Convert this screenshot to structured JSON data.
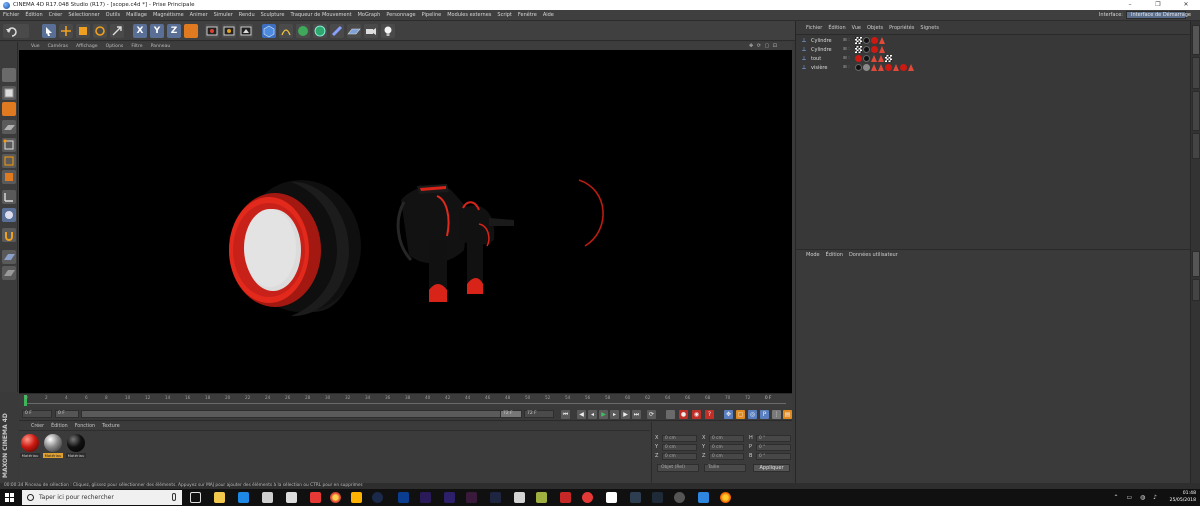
{
  "window": {
    "title": "CINEMA 4D R17.048 Studio (R17) - [scope.c4d *] - Prise Principale",
    "minimize": "–",
    "maximize": "❐",
    "close": "✕"
  },
  "menu": [
    "Fichier",
    "Édition",
    "Créer",
    "Sélectionner",
    "Outils",
    "Maillage",
    "Magnétisme",
    "Animer",
    "Simuler",
    "Rendu",
    "Sculpture",
    "Traqueur de Mouvement",
    "MoGraph",
    "Personnage",
    "Pipeline",
    "Modules externes",
    "Script",
    "Fenêtre",
    "Aide"
  ],
  "interface": {
    "label": "Interface:",
    "value": "Interface de Démarrage"
  },
  "toolbar": {
    "axes": [
      "X",
      "Y",
      "Z"
    ]
  },
  "viewport": {
    "menu": [
      "Vue",
      "Caméras",
      "Affichage",
      "Options",
      "Filtre",
      "Panneau"
    ],
    "controls": "✥ ⟳ ▢ ⊡"
  },
  "timeline": {
    "ticks": [
      "0",
      "2",
      "4",
      "6",
      "8",
      "10",
      "12",
      "14",
      "16",
      "18",
      "20",
      "22",
      "24",
      "26",
      "28",
      "30",
      "32",
      "34",
      "36",
      "38",
      "40",
      "42",
      "44",
      "46",
      "48",
      "50",
      "52",
      "54",
      "56",
      "58",
      "60",
      "62",
      "64",
      "66",
      "68",
      "70",
      "72"
    ],
    "end_label": "0 F",
    "start_field": "0 F",
    "min_field": "0 F",
    "range_end": "72 F",
    "max_field": "72 F"
  },
  "materials": {
    "menu": [
      "Créer",
      "Édition",
      "Fonction",
      "Texture"
    ],
    "items": [
      {
        "name": "Matériau",
        "color": "#cc1a12"
      },
      {
        "name": "Matériau",
        "color": "#8a8a8a"
      },
      {
        "name": "Matériau",
        "color": "#111111"
      }
    ]
  },
  "brand": {
    "text": "MAXON CINEMA 4D"
  },
  "coordinates": {
    "rows": [
      {
        "a": "X",
        "v1": "0 cm",
        "b": "X",
        "v2": "0 cm",
        "c": "H",
        "v3": "0 °"
      },
      {
        "a": "Y",
        "v1": "0 cm",
        "b": "Y",
        "v2": "0 cm",
        "c": "P",
        "v3": "0 °"
      },
      {
        "a": "Z",
        "v1": "0 cm",
        "b": "Z",
        "v2": "0 cm",
        "c": "B",
        "v3": "0 °"
      }
    ],
    "mode": "Objet (Rel)",
    "size": "Taille",
    "apply": "Appliquer"
  },
  "status": {
    "text": "00:00:34    Pinceau de sélection : Cliquez, glissez pour sélectionner des éléments. Appuyez sur MAJ pour ajouter des éléments à la sélection ou CTRL pour en supprimer."
  },
  "objects": {
    "menu": [
      "Fichier",
      "Édition",
      "Vue",
      "Objets",
      "Propriétés",
      "Signets"
    ],
    "rows": [
      {
        "name": "Cylindre",
        "vis": "⊞ :"
      },
      {
        "name": "Cylindre",
        "vis": "⊞ :"
      },
      {
        "name": "tout",
        "vis": "⊞ :"
      },
      {
        "name": "visière",
        "vis": "⊞ :"
      }
    ]
  },
  "attributes": {
    "menu": [
      "Mode",
      "Édition",
      "Données utilisateur"
    ]
  },
  "taskbar": {
    "search_placeholder": "Taper ici pour rechercher",
    "time": "01:48",
    "date": "25/05/2018",
    "tray": "⌃ ▭ ◍ ♪"
  }
}
